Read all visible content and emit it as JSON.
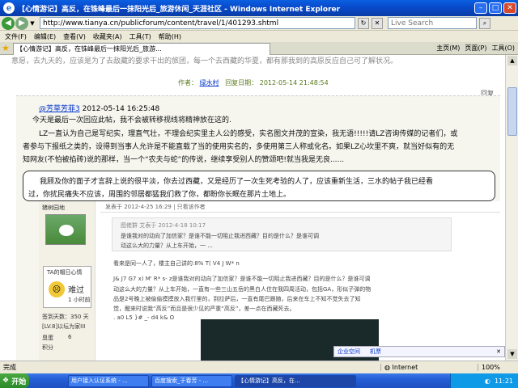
{
  "window": {
    "title": "【心情游记】高反，在铢峰最后一抹阳光后_旅游休闲_天涯社区 - Windows Internet Explorer"
  },
  "address": {
    "url": "http://www.tianya.cn/publicforum/content/travel/1/401293.shtml",
    "search_placeholder": "Live Search"
  },
  "menu": [
    "文件(F)",
    "编辑(E)",
    "查看(V)",
    "收藏夹(A)",
    "工具(T)",
    "帮助(H)"
  ],
  "tab": {
    "title": "【心情游记】高反，在铢峰最后一抹阳光后_旅游...",
    "tools": [
      "主页(M)",
      "页面(P)",
      "工具(O)"
    ]
  },
  "page": {
    "prev_text": "意愿，去九天的，应该是为了去敌藏的要求干出的旅团，每一个去西藏的华夏，都有那我到的高原反应自己可了解状况。",
    "author_label": "作者：",
    "author": "绿水村",
    "time_label": "回复日期：",
    "time": "2012-05-14 21:48:54",
    "reply": "回复",
    "post": {
      "user": "@芳草芳菲3",
      "datetime": "2012-05-14 16:25:48",
      "lines": [
        "今天是最后一次回应此帖，我不会被转移视线将精神放在这的.",
        "LZ一直认为自己是写纪实，理直气壮，不理会纪实里主人公的感受，实名图文并茂的宣染，我无语!!!!!请LZ咨询传媒的记者们，或",
        "者参与下报纸之类的，设得到当事人允许是不能直载了当的使用实名的，多使用第三人称或化名。如果LZ心坎里不爽，就当好似有的无",
        "知网友(不怕被掐砖)说的那样，当一个“农夫与蛇”的传说，继续享受别人的赞颂吧!就当我是无良......"
      ],
      "highlight": [
        "我顾及你的面子才言辞上说的很平淡，你去过西藏，又是经历了一次生死考验的人了，应该重新生活，三水的帖子我已经看",
        "过，你扰民痛失不应该，周围的邻居都猛我们救了你，都盼你长眠在那片土地上。"
      ]
    },
    "embedded": {
      "sidebar_name": "猪树园地",
      "sidebar_lines": [
        "TA的帽日心情",
        "难过",
        "1 小时前",
        "签到天数：350 天",
        "[LV.8]以坛为家III",
        "臭蛋",
        "6",
        "积分"
      ],
      "header": "发表于 2012-4-25 16:29 | 只看该作者",
      "quote_lines": [
        "图佬群 艾表于 2012-4-18 10:17",
        "是谁我对的动向了加信家？是谁不能一切阻止我进西藏？目的是什么？是谁可调",
        "动这么大的力量？从上车开始，一 ..."
      ],
      "body_lines": [
        "看来是同一人了，楼主自己讲的:8% T( V4 J W* n",
        " J& J7 G7 x) M' R* s- z是谁我对的动向了加信家？是谁不能一切阻止我进西藏？目的是什么？是谁可调",
        "动这么大的力量？从上车开始，一直有一些三山五岳的黑白人住在我四周活动，包括GA，形似子弹的物",
        "品是2号晚上被偷偷摸摸放入我行里的，到拉萨后，一直有尾巴跟随，后来在车上不知不觉失去了知",
        "觉，醒来时说我“高反”而且是很少见的严重“高反”，差一点在西藏死去。",
        ". a0 L5 }# _- d4 k& O"
      ]
    }
  },
  "qq": {
    "items": [
      "企业空间",
      "机票"
    ]
  },
  "status": {
    "text": "完成",
    "zone": "Internet",
    "zoom": "100%"
  },
  "taskbar": {
    "start": "开始",
    "items": [
      "用户接入认证系统 - ...",
      "百度搜索_于春芳 - ...",
      "【心情游记】高反，在..."
    ],
    "time": "11:21"
  }
}
